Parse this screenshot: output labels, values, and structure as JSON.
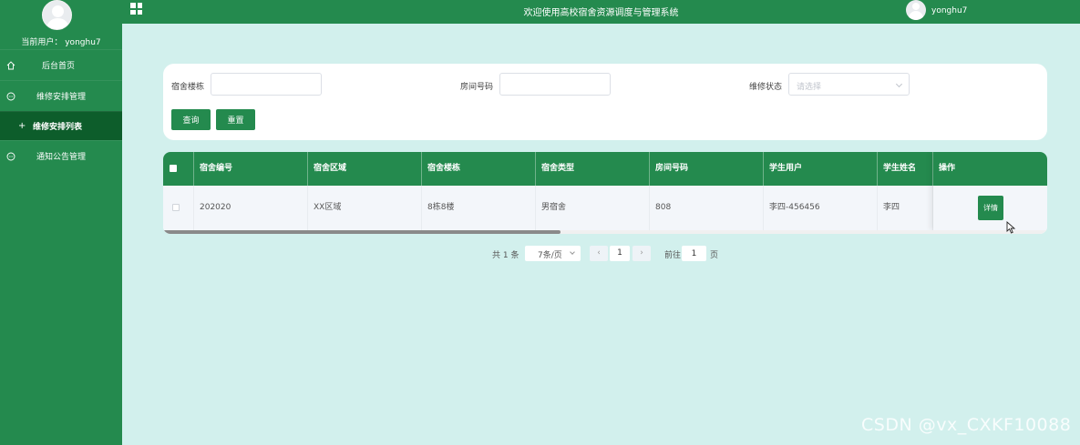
{
  "sidebar": {
    "current_user_label": "当前用户： yonghu7",
    "items": [
      {
        "label": "后台首页",
        "icon": "home-icon"
      },
      {
        "label": "维修安排管理",
        "icon": "chat-icon"
      },
      {
        "label": "维修安排列表",
        "prefix": "+"
      },
      {
        "label": "通知公告管理",
        "icon": "chat-icon"
      }
    ]
  },
  "header": {
    "title": "欢迎使用高校宿舍资源调度与管理系统",
    "username": "yonghu7",
    "menu_icon": "grid-icon"
  },
  "search": {
    "building_label": "宿舍楼栋",
    "building_value": "",
    "room_label": "房间号码",
    "room_value": "",
    "status_label": "维修状态",
    "status_placeholder": "请选择",
    "query_label": "查询",
    "reset_label": "重置"
  },
  "table": {
    "columns": [
      "宿舍编号",
      "宿舍区域",
      "宿舍楼栋",
      "宿舍类型",
      "房间号码",
      "学生用户",
      "学生姓名",
      "操作"
    ],
    "rows": [
      {
        "cells": [
          "202020",
          "XX区域",
          "8栋8楼",
          "男宿舍",
          "808",
          "李四-456456",
          "李四"
        ],
        "action": "详情"
      }
    ]
  },
  "pagination": {
    "total": "共 1 条",
    "page_size": "7条/页",
    "current_page": "1",
    "goto_label": "前往",
    "goto_value": "1",
    "page_suffix": "页",
    "prev": "‹",
    "next": "›"
  },
  "watermark": "CSDN @vx_CXKF10088",
  "colors": {
    "primary": "#248a4e",
    "sidebar_active": "#0d5d2b",
    "background": "#d2f0ed"
  }
}
